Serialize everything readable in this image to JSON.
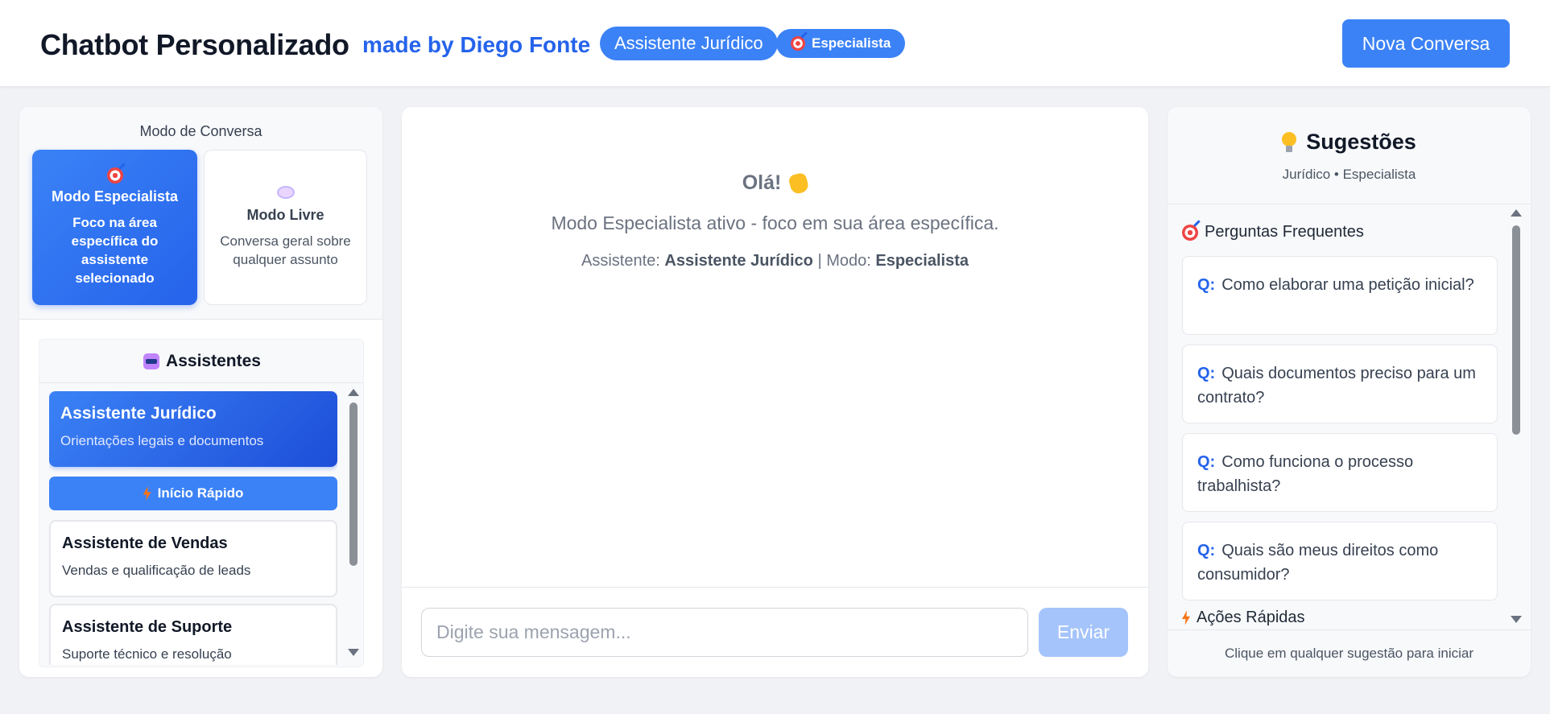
{
  "header": {
    "title": "Chatbot Personalizado",
    "credit": "made by Diego Fonte",
    "assistant_pill": "Assistente Jurídico",
    "mode_pill": "Especialista",
    "new_chat_button": "Nova Conversa"
  },
  "mode_section": {
    "heading": "Modo de Conversa",
    "specialist": {
      "icon": "target-icon",
      "title": "Modo Especialista",
      "description": "Foco na área específica do assistente selecionado"
    },
    "free": {
      "icon": "speech-bubble-icon",
      "title": "Modo Livre",
      "description": "Conversa geral sobre qualquer assunto"
    }
  },
  "assistants": {
    "heading": "Assistentes",
    "quick_start": "Início Rápido",
    "items": [
      {
        "name": "Assistente Jurídico",
        "description": "Orientações legais e documentos"
      },
      {
        "name": "Assistente de Vendas",
        "description": "Vendas e qualificação de leads"
      },
      {
        "name": "Assistente de Suporte",
        "description": "Suporte técnico e resolução"
      }
    ]
  },
  "chat": {
    "greeting": "Olá!",
    "mode_info": "Modo Especialista ativo - foco em sua área específica.",
    "assistant_label": "Assistente:",
    "assistant_value": "Assistente Jurídico",
    "separator": "|",
    "mode_label": "Modo:",
    "mode_value": "Especialista",
    "input_placeholder": "Digite sua mensagem...",
    "send_button": "Enviar"
  },
  "suggestions": {
    "title": "Sugestões",
    "subtitle": "Jurídico • Especialista",
    "faq_heading": "Perguntas Frequentes",
    "q_prefix": "Q:",
    "faq": [
      "Como elaborar uma petição inicial?",
      "Quais documentos preciso para um contrato?",
      "Como funciona o processo trabalhista?",
      "Quais são meus direitos como consumidor?"
    ],
    "quick_actions_heading": "Ações Rápidas",
    "footer": "Clique em qualquer sugestão para iniciar"
  },
  "colors": {
    "accent": "#3b82f6",
    "accent_dark": "#2563eb",
    "background": "#f1f2f5"
  }
}
